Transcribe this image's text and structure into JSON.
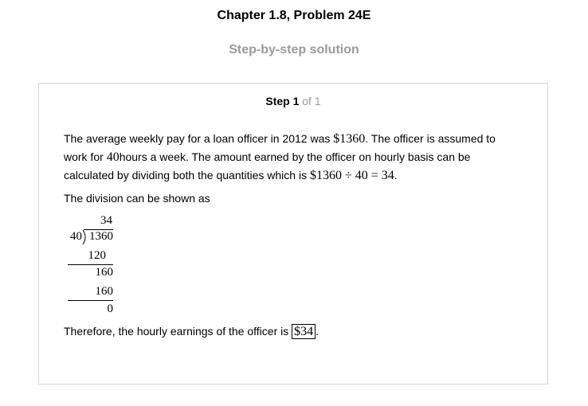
{
  "header": {
    "title": "Chapter 1.8, Problem 24E",
    "subtitle": "Step-by-step solution"
  },
  "step": {
    "label": "Step 1",
    "of": "of 1"
  },
  "body": {
    "line1_a": "The average weekly pay for a loan officer in 2012 was ",
    "pay": "$1360",
    "line1_b": ". The officer is assumed to",
    "line2_a": "work for ",
    "hours": "40",
    "line2_b": "hours a week. The amount earned by the officer on hourly basis can be",
    "line3_a": "calculated by dividing both the quantities which is ",
    "equation": "$1360 ÷ 40 = 34",
    "line3_b": ".",
    "line4": "The division can be shown as",
    "conclusion_a": "Therefore, the hourly earnings of the officer is ",
    "answer": "$34",
    "conclusion_b": "."
  },
  "long_division": {
    "quotient": "34",
    "divisor": "40",
    "dividend": "1360",
    "sub1": "120",
    "rem1": "160",
    "sub2": "160",
    "remainder": "0"
  }
}
